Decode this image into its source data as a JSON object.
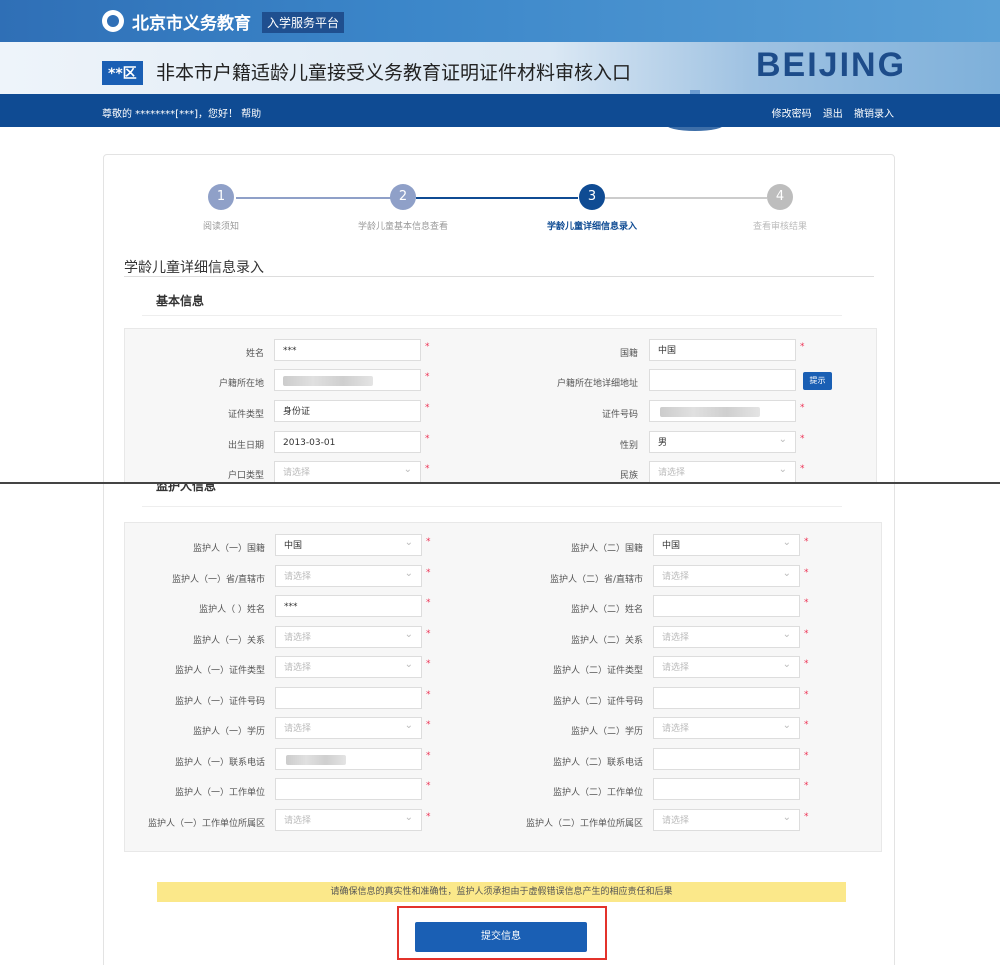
{
  "header": {
    "brand": "北京市义务教育",
    "brand_sub": "入学服务平台",
    "district": "**区",
    "system_title": "非本市户籍适龄儿童接受义务教育证明证件材料审核入口",
    "beijing_text": "BEIJING"
  },
  "navbar": {
    "greeting": "尊敬的 ********[***]，您好！  帮助",
    "links": [
      "修改密码",
      "退出",
      "撤销录入"
    ]
  },
  "steps": [
    {
      "num": "1",
      "label": "阅读须知",
      "color": "#8fa0c8"
    },
    {
      "num": "2",
      "label": "学龄儿童基本信息查看",
      "color": "#8fa0c8"
    },
    {
      "num": "3",
      "label": "学龄儿童详细信息录入",
      "color": "#0f4b93"
    },
    {
      "num": "4",
      "label": "查看审核结果",
      "color": "#bdbdbd"
    }
  ],
  "section_title": "学龄儿童详细信息录入",
  "basic": {
    "title": "基本信息",
    "rows": [
      {
        "l_label": "姓名",
        "l_value": "***",
        "r_label": "国籍",
        "r_value": "中国"
      },
      {
        "l_label": "户籍所在地",
        "l_value": "",
        "r_label": "户籍所在地详细地址",
        "r_value": ""
      },
      {
        "l_label": "证件类型",
        "l_value": "身份证",
        "r_label": "证件号码",
        "r_value": ""
      },
      {
        "l_label": "出生日期",
        "l_value": "2013-03-01",
        "r_label": "性别",
        "r_value": "男"
      },
      {
        "l_label": "户口类型",
        "l_value": "请选择",
        "r_label": "民族",
        "r_value": "请选择"
      }
    ],
    "hint_button": "提示"
  },
  "guardian": {
    "title": "监护人信息",
    "rows": [
      {
        "l_label": "监护人（一）国籍",
        "l_value": "中国",
        "r_label": "监护人（二）国籍",
        "r_value": "中国"
      },
      {
        "l_label": "监护人（一）省/直辖市",
        "l_value": "请选择",
        "r_label": "监护人（二）省/直辖市",
        "r_value": "请选择"
      },
      {
        "l_label": "监护人（ ）姓名",
        "l_value": "***",
        "r_label": "监护人（二）姓名",
        "r_value": ""
      },
      {
        "l_label": "监护人（一）关系",
        "l_value": "请选择",
        "r_label": "监护人（二）关系",
        "r_value": "请选择"
      },
      {
        "l_label": "监护人（一）证件类型",
        "l_value": "请选择",
        "r_label": "监护人（二）证件类型",
        "r_value": "请选择"
      },
      {
        "l_label": "监护人（一）证件号码",
        "l_value": "",
        "r_label": "监护人（二）证件号码",
        "r_value": ""
      },
      {
        "l_label": "监护人（一）学历",
        "l_value": "请选择",
        "r_label": "监护人（二）学历",
        "r_value": "请选择"
      },
      {
        "l_label": "监护人（一）联系电话",
        "l_value": "",
        "r_label": "监护人（二）联系电话",
        "r_value": ""
      },
      {
        "l_label": "监护人（一）工作单位",
        "l_value": "",
        "r_label": "监护人（二）工作单位",
        "r_value": ""
      },
      {
        "l_label": "监护人（一）工作单位所属区",
        "l_value": "请选择",
        "r_label": "监护人（二）工作单位所属区",
        "r_value": "请选择"
      }
    ]
  },
  "notice": "请确保信息的真实性和准确性，监护人须承担由于虚假错误信息产生的相应责任和后果",
  "submit_label": "提交信息"
}
